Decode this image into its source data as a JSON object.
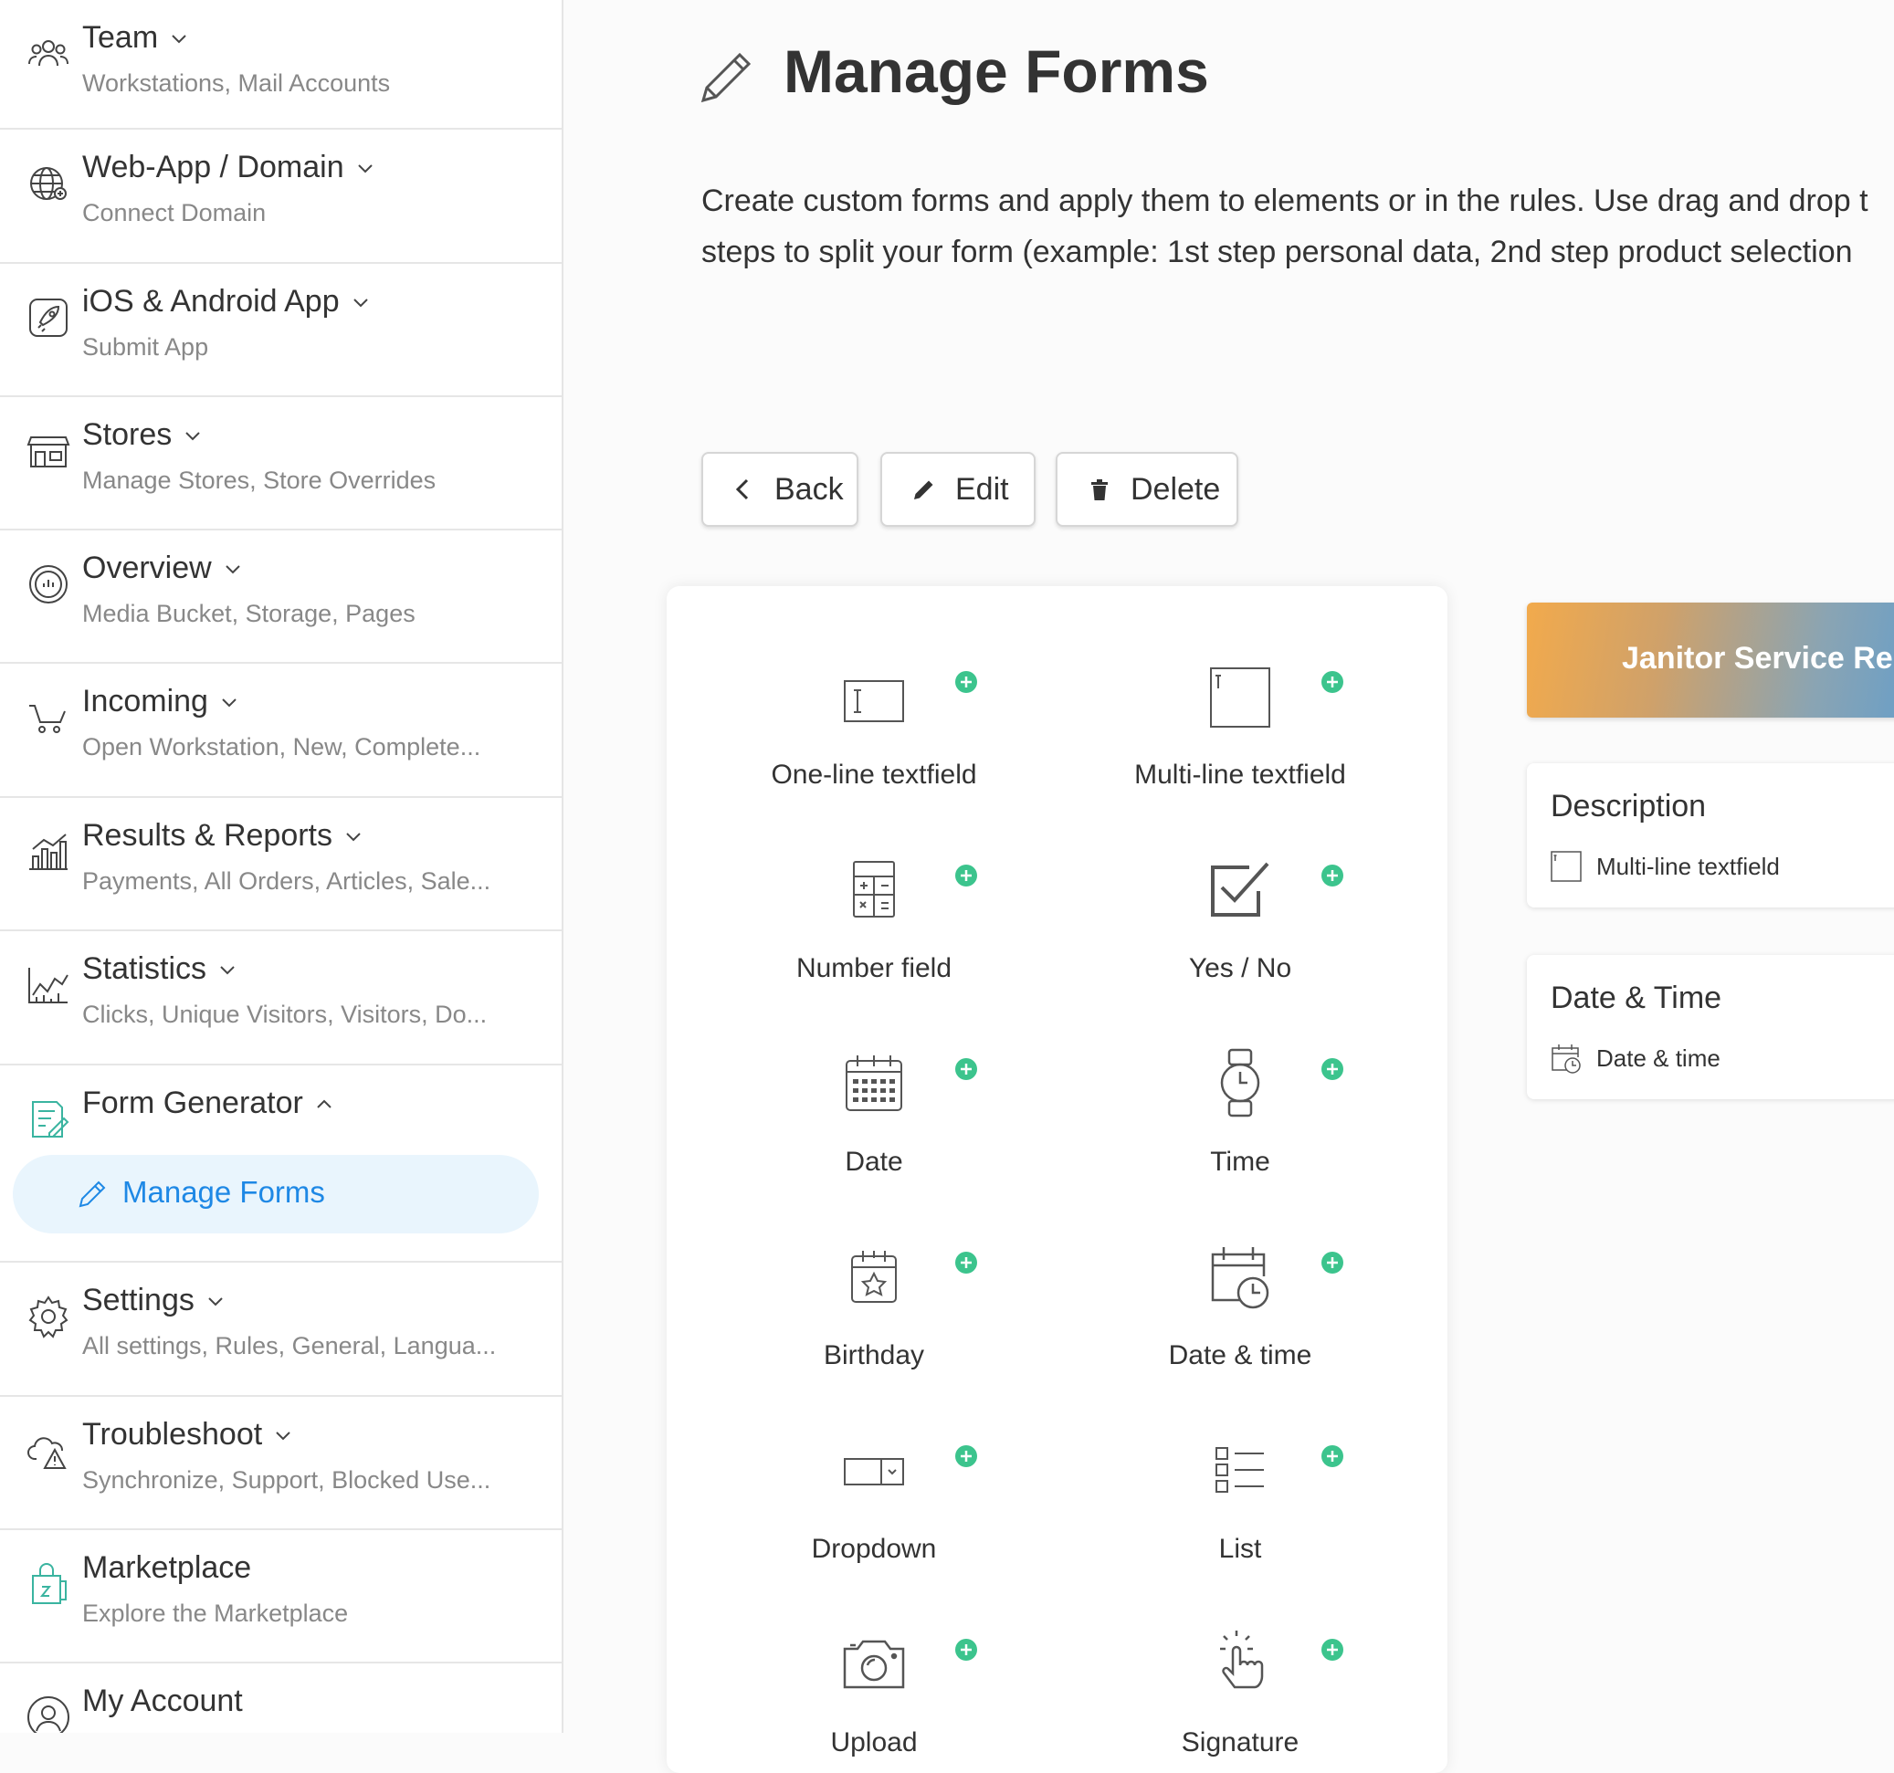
{
  "sidebar": {
    "items": [
      {
        "title": "Team",
        "sub": "Workstations, Mail Accounts",
        "icon": "team-icon"
      },
      {
        "title": "Web-App / Domain",
        "sub": "Connect Domain",
        "icon": "globe-icon"
      },
      {
        "title": "iOS & Android App",
        "sub": "Submit App",
        "icon": "rocket-icon"
      },
      {
        "title": "Stores",
        "sub": "Manage Stores, Store Overrides",
        "icon": "store-icon"
      },
      {
        "title": "Overview",
        "sub": "Media Bucket, Storage, Pages",
        "icon": "gauge-icon"
      },
      {
        "title": "Incoming",
        "sub": "Open Workstation, New, Complete...",
        "icon": "cart-icon"
      },
      {
        "title": "Results & Reports",
        "sub": "Payments, All Orders, Articles, Sale...",
        "icon": "bar-chart-icon"
      },
      {
        "title": "Statistics",
        "sub": "Clicks, Unique Visitors, Visitors, Do...",
        "icon": "line-chart-icon"
      },
      {
        "title": "Form Generator",
        "sub": "",
        "icon": "form-icon"
      },
      {
        "title": "Settings",
        "sub": "All settings, Rules, General, Langua...",
        "icon": "gear-icon"
      },
      {
        "title": "Troubleshoot",
        "sub": "Synchronize, Support, Blocked Use...",
        "icon": "cloud-warning-icon"
      },
      {
        "title": "Marketplace",
        "sub": "Explore the Marketplace",
        "icon": "shopping-bag-icon"
      },
      {
        "title": "My Account",
        "sub": "",
        "icon": "user-icon"
      }
    ],
    "active_sub": "Manage Forms"
  },
  "main": {
    "title": "Manage Forms",
    "description_lines": [
      "Create custom forms and apply them to elements or in the rules. Use drag and drop t",
      "steps to split your form (example: 1st step personal data, 2nd step product selection"
    ],
    "buttons": {
      "back": "Back",
      "edit": "Edit",
      "delete": "Delete"
    }
  },
  "palette": [
    {
      "label": "One-line textfield",
      "icon": "textfield-icon"
    },
    {
      "label": "Multi-line textfield",
      "icon": "textarea-icon"
    },
    {
      "label": "Number field",
      "icon": "calculator-icon"
    },
    {
      "label": "Yes / No",
      "icon": "checkbox-icon"
    },
    {
      "label": "Date",
      "icon": "calendar-icon"
    },
    {
      "label": "Time",
      "icon": "watch-icon"
    },
    {
      "label": "Birthday",
      "icon": "birthday-calendar-icon"
    },
    {
      "label": "Date & time",
      "icon": "calendar-clock-icon"
    },
    {
      "label": "Dropdown",
      "icon": "dropdown-icon"
    },
    {
      "label": "List",
      "icon": "list-icon"
    },
    {
      "label": "Upload",
      "icon": "camera-icon"
    },
    {
      "label": "Signature",
      "icon": "hand-pointer-icon"
    }
  ],
  "form_preview": {
    "title": "Janitor Service Req",
    "fields": [
      {
        "title": "Description",
        "type": "Multi-line textfield"
      },
      {
        "title": "Date & Time",
        "type": "Date & time"
      }
    ]
  },
  "colors": {
    "accent": "#1e88e5",
    "plus": "#3cc48d",
    "active_bg": "#e9f5fd"
  }
}
